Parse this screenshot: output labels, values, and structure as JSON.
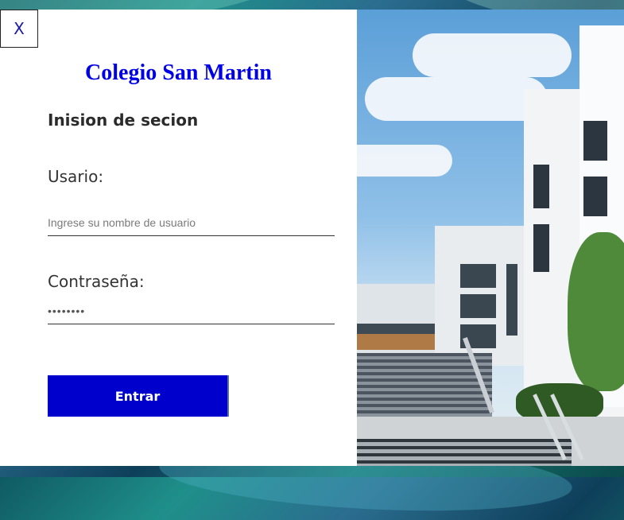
{
  "close_button": {
    "label": "X"
  },
  "brand": {
    "title": "Colegio San Martin"
  },
  "form": {
    "heading": "Inision de secion",
    "username": {
      "label": "Usario:",
      "placeholder": "Ingrese su nombre de usuario",
      "value": ""
    },
    "password": {
      "label": "Contraseña:",
      "value": "••••••••"
    },
    "submit_label": "Entrar"
  },
  "colors": {
    "brand_blue": "#0000e6",
    "button_blue": "#0000cd",
    "panel_bg": "#ffffff"
  },
  "icons": {
    "close": "close-icon"
  }
}
